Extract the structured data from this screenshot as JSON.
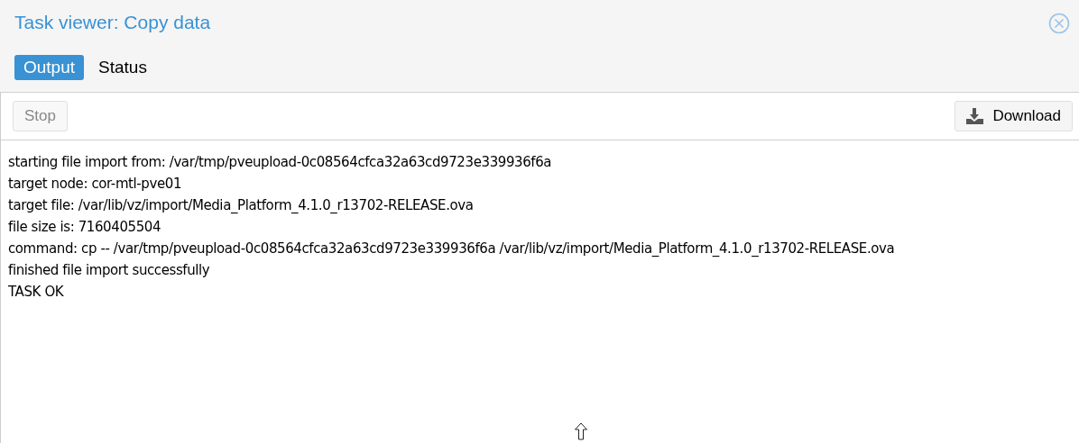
{
  "window": {
    "title": "Task viewer: Copy data"
  },
  "tabs": [
    {
      "label": "Output",
      "selected": true
    },
    {
      "label": "Status",
      "selected": false
    }
  ],
  "toolbar": {
    "buttons": [
      {
        "label": "Stop",
        "disabled": true,
        "kind": "stop"
      },
      {
        "label": "Download",
        "disabled": false,
        "kind": "download"
      }
    ]
  },
  "log": [
    "starting file import from: /var/tmp/pveupload-0c08564cfca32a63cd9723e339936f6a",
    "target node: cor-mtl-pve01",
    "target file: /var/lib/vz/import/Media_Platform_4.1.0_r13702-RELEASE.ova",
    "file size is: 7160405504",
    "command: cp -- /var/tmp/pveupload-0c08564cfca32a63cd9723e339936f6a /var/lib/vz/import/Media_Platform_4.1.0_r13702-RELEASE.ova",
    "finished file import successfully",
    "TASK OK"
  ]
}
